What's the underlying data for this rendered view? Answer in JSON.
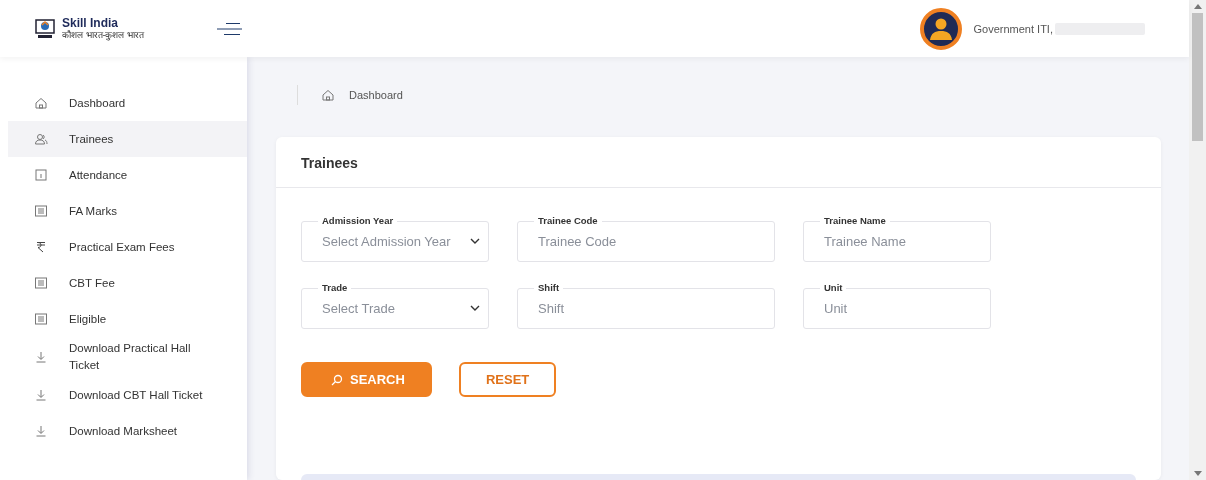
{
  "header": {
    "brand": "Skill India",
    "tagline": "कौशल भारत-कुशल भारत",
    "user_name": "Government ITI,"
  },
  "sidebar": {
    "items": [
      {
        "label": "Dashboard",
        "selected": false
      },
      {
        "label": "Trainees",
        "selected": true
      },
      {
        "label": "Attendance",
        "selected": false
      },
      {
        "label": "FA Marks",
        "selected": false
      },
      {
        "label": "Practical Exam Fees",
        "selected": false
      },
      {
        "label": "CBT Fee",
        "selected": false
      },
      {
        "label": "Eligible",
        "selected": false
      },
      {
        "label": "Download Practical Hall Ticket",
        "selected": false
      },
      {
        "label": "Download CBT Hall Ticket",
        "selected": false
      },
      {
        "label": "Download Marksheet",
        "selected": false
      }
    ]
  },
  "breadcrumb": [
    "Dashboard"
  ],
  "card": {
    "title": "Trainees",
    "fields": [
      {
        "label": "Admission Year",
        "placeholder": "Select Admission Year",
        "kind": "select"
      },
      {
        "label": "Trainee Code",
        "placeholder": "Trainee Code",
        "kind": "text"
      },
      {
        "label": "Trainee Name",
        "placeholder": "Trainee Name",
        "kind": "text"
      },
      {
        "label": "Trade",
        "placeholder": "Select Trade",
        "kind": "select"
      },
      {
        "label": "Shift",
        "placeholder": "Shift",
        "kind": "text"
      },
      {
        "label": "Unit",
        "placeholder": "Unit",
        "kind": "text"
      }
    ],
    "buttons": [
      {
        "label": "SEARCH",
        "kind": "primary"
      },
      {
        "label": "RESET",
        "kind": "outline"
      }
    ]
  }
}
